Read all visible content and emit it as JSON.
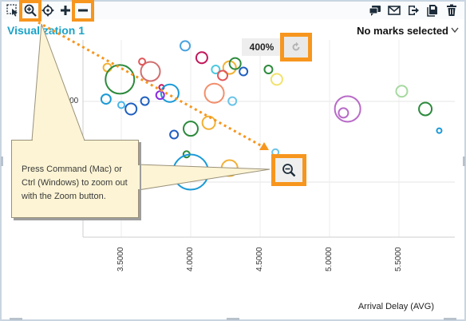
{
  "toolbar": {
    "left_tools": [
      {
        "name": "select",
        "icon": "select-arrow-icon"
      },
      {
        "name": "zoom-in",
        "icon": "zoom-in-magnifier-icon"
      },
      {
        "name": "pan",
        "icon": "pan-target-icon"
      },
      {
        "name": "expand",
        "icon": "plus-icon"
      },
      {
        "name": "collapse",
        "icon": "minus-icon"
      }
    ],
    "right_tools": [
      {
        "name": "comments",
        "icon": "comments-icon"
      },
      {
        "name": "email",
        "icon": "email-icon"
      },
      {
        "name": "export",
        "icon": "export-icon"
      },
      {
        "name": "copy",
        "icon": "copy-icon"
      },
      {
        "name": "delete",
        "icon": "trash-icon"
      }
    ],
    "highlight_color": "#f7961e"
  },
  "visualization": {
    "title": "Visualization 1",
    "selection_status": "No marks selected",
    "zoom_level": "400%",
    "title_color": "#1aa2c8"
  },
  "callout": {
    "text": "Press Command (Mac) or Ctrl (Windows) to zoom out with the Zoom button."
  },
  "chart_data": {
    "type": "scatter",
    "xlabel": "Arrival Delay (AVG)",
    "x_ticks": [
      "3.5000",
      "4.0000",
      "4.5000",
      "5.0000",
      "5.5000"
    ],
    "y_ticks": [
      "0000"
    ],
    "points": [
      {
        "x": 3.4,
        "y": 0.86,
        "r": 5,
        "color": "#f2b134"
      },
      {
        "x": 3.49,
        "y": 0.8,
        "r": 18,
        "color": "#2c8a3c"
      },
      {
        "x": 3.39,
        "y": 0.7,
        "r": 6,
        "color": "#1a9ad6"
      },
      {
        "x": 3.5,
        "y": 0.67,
        "r": 4,
        "color": "#49b5e8"
      },
      {
        "x": 3.57,
        "y": 0.65,
        "r": 7,
        "color": "#1f5fbf"
      },
      {
        "x": 3.71,
        "y": 0.84,
        "r": 12,
        "color": "#d16f6f"
      },
      {
        "x": 3.65,
        "y": 0.89,
        "r": 4,
        "color": "#e15759"
      },
      {
        "x": 3.79,
        "y": 0.76,
        "r": 3,
        "color": "#c2185b"
      },
      {
        "x": 3.85,
        "y": 0.73,
        "r": 11,
        "color": "#1a9ad6"
      },
      {
        "x": 3.78,
        "y": 0.72,
        "r": 5,
        "color": "#8a2be2"
      },
      {
        "x": 3.67,
        "y": 0.69,
        "r": 5,
        "color": "#1f5fbf"
      },
      {
        "x": 3.96,
        "y": 0.97,
        "r": 6,
        "color": "#4aa3df"
      },
      {
        "x": 4.08,
        "y": 0.91,
        "r": 7,
        "color": "#c2185b"
      },
      {
        "x": 4.18,
        "y": 0.85,
        "r": 5,
        "color": "#4cc9e0"
      },
      {
        "x": 4.28,
        "y": 0.86,
        "r": 8,
        "color": "#f2b134"
      },
      {
        "x": 4.32,
        "y": 0.88,
        "r": 7,
        "color": "#2c8a3c"
      },
      {
        "x": 4.23,
        "y": 0.82,
        "r": 6,
        "color": "#e15759"
      },
      {
        "x": 4.17,
        "y": 0.73,
        "r": 12,
        "color": "#f28e6b"
      },
      {
        "x": 4.38,
        "y": 0.84,
        "r": 5,
        "color": "#1f5fbf"
      },
      {
        "x": 4.56,
        "y": 0.85,
        "r": 5,
        "color": "#2c8a3c"
      },
      {
        "x": 4.62,
        "y": 0.8,
        "r": 7,
        "color": "#f2e26b"
      },
      {
        "x": 4.3,
        "y": 0.69,
        "r": 5,
        "color": "#6bc4e8"
      },
      {
        "x": 5.13,
        "y": 0.65,
        "r": 16,
        "color": "#b86bc7"
      },
      {
        "x": 5.1,
        "y": 0.63,
        "r": 6,
        "color": "#b86bc7"
      },
      {
        "x": 5.52,
        "y": 0.74,
        "r": 7,
        "color": "#a6d9a0"
      },
      {
        "x": 5.69,
        "y": 0.65,
        "r": 8,
        "color": "#2c8a3c"
      },
      {
        "x": 5.79,
        "y": 0.54,
        "r": 3,
        "color": "#1a9ad6"
      },
      {
        "x": 4.0,
        "y": 0.55,
        "r": 9,
        "color": "#2c8a3c"
      },
      {
        "x": 4.13,
        "y": 0.58,
        "r": 8,
        "color": "#f2b134"
      },
      {
        "x": 3.88,
        "y": 0.52,
        "r": 5,
        "color": "#1f5fbf"
      },
      {
        "x": 3.97,
        "y": 0.42,
        "r": 4,
        "color": "#2c8a3c"
      },
      {
        "x": 4.61,
        "y": 0.43,
        "r": 4,
        "color": "#6bc4e8"
      },
      {
        "x": 4.0,
        "y": 0.33,
        "r": 22,
        "color": "#1a9ad6"
      },
      {
        "x": 4.28,
        "y": 0.35,
        "r": 10,
        "color": "#f2b134"
      }
    ],
    "grid": true
  }
}
